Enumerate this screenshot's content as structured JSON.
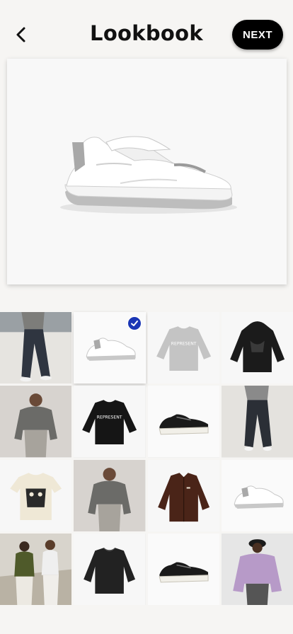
{
  "header": {
    "back_icon": "chevron-left-icon",
    "title": "Lookbook",
    "next_label": "NEXT"
  },
  "preview": {
    "item": "white-sneaker"
  },
  "colors": {
    "accent": "#1a36b5",
    "button": "#000000",
    "background": "#f6f5f3"
  },
  "grid": {
    "tiles": [
      {
        "kind": "person-jeans-photo",
        "selected": false
      },
      {
        "kind": "white-sneaker",
        "selected": true
      },
      {
        "kind": "grey-sweater",
        "selected": false,
        "text": "REPRESENT"
      },
      {
        "kind": "black-hoodie",
        "selected": false
      },
      {
        "kind": "person-grey-sweatshirt-photo",
        "selected": false
      },
      {
        "kind": "black-sweater",
        "selected": false,
        "text": "REPRESENT"
      },
      {
        "kind": "black-sneaker",
        "selected": false
      },
      {
        "kind": "person-dark-jeans-photo",
        "selected": false
      },
      {
        "kind": "cream-graphic-tee",
        "selected": false
      },
      {
        "kind": "person-grey-sweatshirt-photo",
        "selected": false
      },
      {
        "kind": "brown-jacket",
        "selected": false
      },
      {
        "kind": "white-sneaker",
        "selected": false
      },
      {
        "kind": "two-people-photo",
        "selected": false
      },
      {
        "kind": "black-knit-sweater",
        "selected": false
      },
      {
        "kind": "black-sneaker",
        "selected": false
      },
      {
        "kind": "person-purple-jacket-photo",
        "selected": false
      }
    ]
  }
}
